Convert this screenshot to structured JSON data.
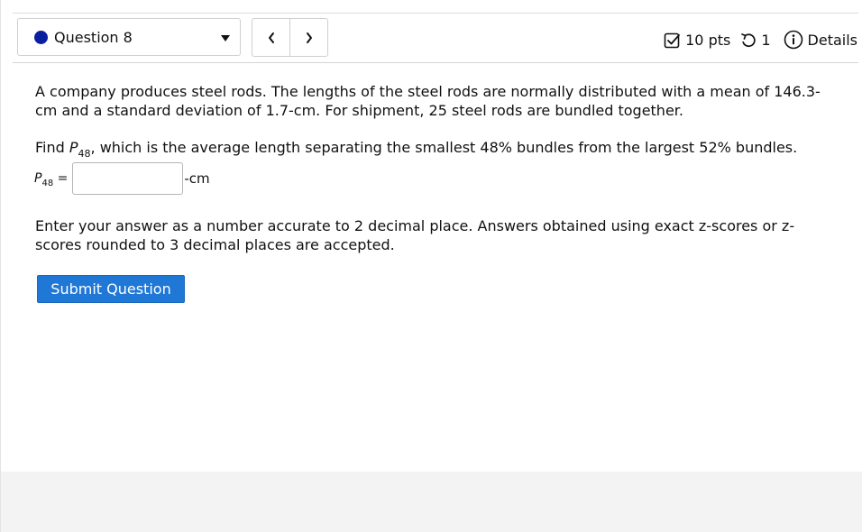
{
  "question_selector": {
    "label": "Question 8"
  },
  "nav": {
    "prev_icon": "chevron-left-icon",
    "next_icon": "chevron-right-icon"
  },
  "meta": {
    "points": "10 pts",
    "attempts": "1",
    "details": "Details"
  },
  "question": {
    "paragraph1": "A company produces steel rods. The lengths of the steel rods are normally distributed with a mean of 146.3-cm and a standard deviation of 1.7-cm. For shipment, 25 steel rods are bundled together.",
    "p2_find": "Find ",
    "p_symbol": "P",
    "p_sub": "48",
    "p2_rest": ", which is the average length separating the smallest 48% bundles from the largest 52% bundles.",
    "answer_eq": " =",
    "answer_value": "",
    "unit": "-cm",
    "paragraph3": "Enter your answer as a number accurate to 2 decimal place. Answers obtained using exact z-scores or z-scores rounded to 3 decimal places are accepted."
  },
  "submit": {
    "label": "Submit Question"
  },
  "colors": {
    "accent": "#1f77d6",
    "dot": "#0a1f9f"
  }
}
